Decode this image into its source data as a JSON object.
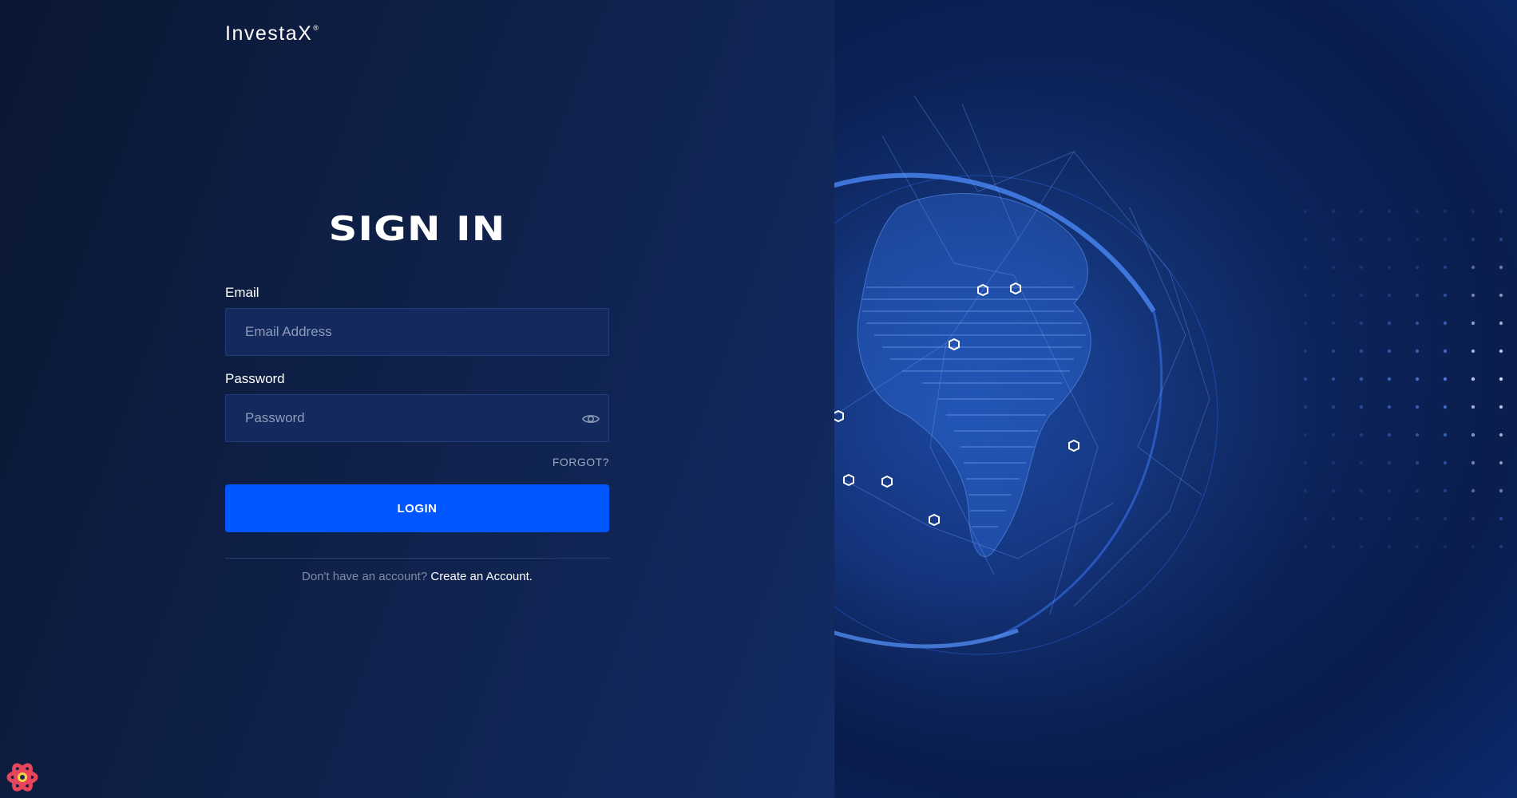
{
  "brand": {
    "name": "InvestaX",
    "mark": "®"
  },
  "form": {
    "title": "SIGN IN",
    "email": {
      "label": "Email",
      "placeholder": "Email Address",
      "value": ""
    },
    "password": {
      "label": "Password",
      "placeholder": "Password",
      "value": ""
    },
    "forgot_label": "FORGOT?",
    "login_label": "LOGIN",
    "signup_prompt": "Don't have an account?",
    "signup_link": "Create an Account."
  },
  "icons": {
    "password_toggle": "eye-icon",
    "devtools": "react-devtools-icon",
    "hero": "digital-globe-illustration"
  },
  "colors": {
    "background": "#0b1a3a",
    "input_background": "#142a5e",
    "primary_button": "#0057ff",
    "muted_text": "#7f8aa6"
  }
}
